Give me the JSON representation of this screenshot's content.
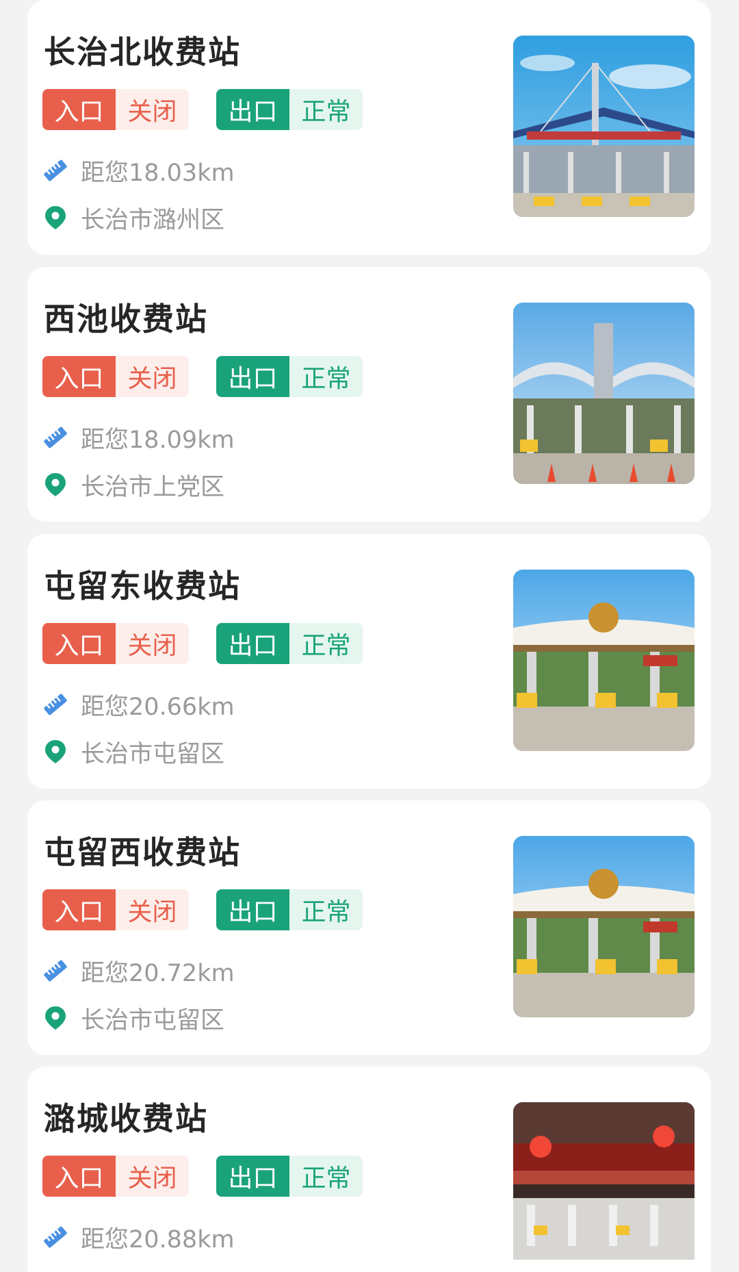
{
  "stations": [
    {
      "name": "长治北收费站",
      "entry_label": "入口",
      "entry_status": "关闭",
      "exit_label": "出口",
      "exit_status": "正常",
      "distance": "距您18.03km",
      "location": "长治市潞州区",
      "photo": "toll-station-photo"
    },
    {
      "name": "西池收费站",
      "entry_label": "入口",
      "entry_status": "关闭",
      "exit_label": "出口",
      "exit_status": "正常",
      "distance": "距您18.09km",
      "location": "长治市上党区",
      "photo": "toll-station-photo"
    },
    {
      "name": "屯留东收费站",
      "entry_label": "入口",
      "entry_status": "关闭",
      "exit_label": "出口",
      "exit_status": "正常",
      "distance": "距您20.66km",
      "location": "长治市屯留区",
      "photo": "toll-station-photo"
    },
    {
      "name": "屯留西收费站",
      "entry_label": "入口",
      "entry_status": "关闭",
      "exit_label": "出口",
      "exit_status": "正常",
      "distance": "距您20.72km",
      "location": "长治市屯留区",
      "photo": "toll-station-photo"
    },
    {
      "name": "潞城收费站",
      "entry_label": "入口",
      "entry_status": "关闭",
      "exit_label": "出口",
      "exit_status": "正常",
      "distance": "距您20.88km",
      "location": "",
      "photo": "toll-station-photo"
    }
  ],
  "icons": {
    "distance": "ruler-icon",
    "location": "location-pin-icon"
  },
  "colors": {
    "closed": "#e8604c",
    "closed_bg": "#fdeeeb",
    "normal": "#1aa37a",
    "normal_bg": "#e5f6ef",
    "distance_icon": "#4a90e2",
    "location_icon": "#1aa37a"
  }
}
